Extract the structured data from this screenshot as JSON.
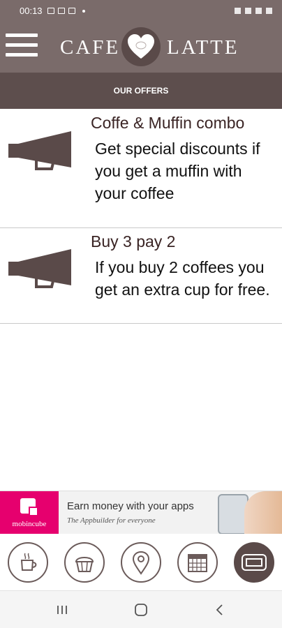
{
  "status_bar": {
    "time": "00:13",
    "notification_dot": "•"
  },
  "header": {
    "brand_left": "CAFE",
    "brand_right": "LATTE",
    "logo_text": "CAFE"
  },
  "page": {
    "title": "OUR OFFERS"
  },
  "offers": [
    {
      "title": "Coffe & Muffin combo",
      "description": "Get special discounts if you get a muffin with your coffee"
    },
    {
      "title": "Buy 3 pay 2",
      "description": "If you buy 2 coffees you get an extra cup for free."
    }
  ],
  "ad": {
    "brand": "mobincube",
    "headline": "Earn money with your apps",
    "subline": "The Appbuilder for everyone"
  },
  "tabs": [
    {
      "name": "coffee",
      "icon": "coffee-cup-icon",
      "active": false
    },
    {
      "name": "muffin",
      "icon": "muffin-icon",
      "active": false
    },
    {
      "name": "location",
      "icon": "map-pin-icon",
      "active": false
    },
    {
      "name": "calendar",
      "icon": "calendar-icon",
      "active": false
    },
    {
      "name": "offers",
      "icon": "ticket-icon",
      "active": true
    }
  ],
  "colors": {
    "header": "#7a6b6a",
    "title_bar": "#5d4e4d",
    "accent_brown": "#5a4a49",
    "ad_pink": "#e6006e"
  }
}
